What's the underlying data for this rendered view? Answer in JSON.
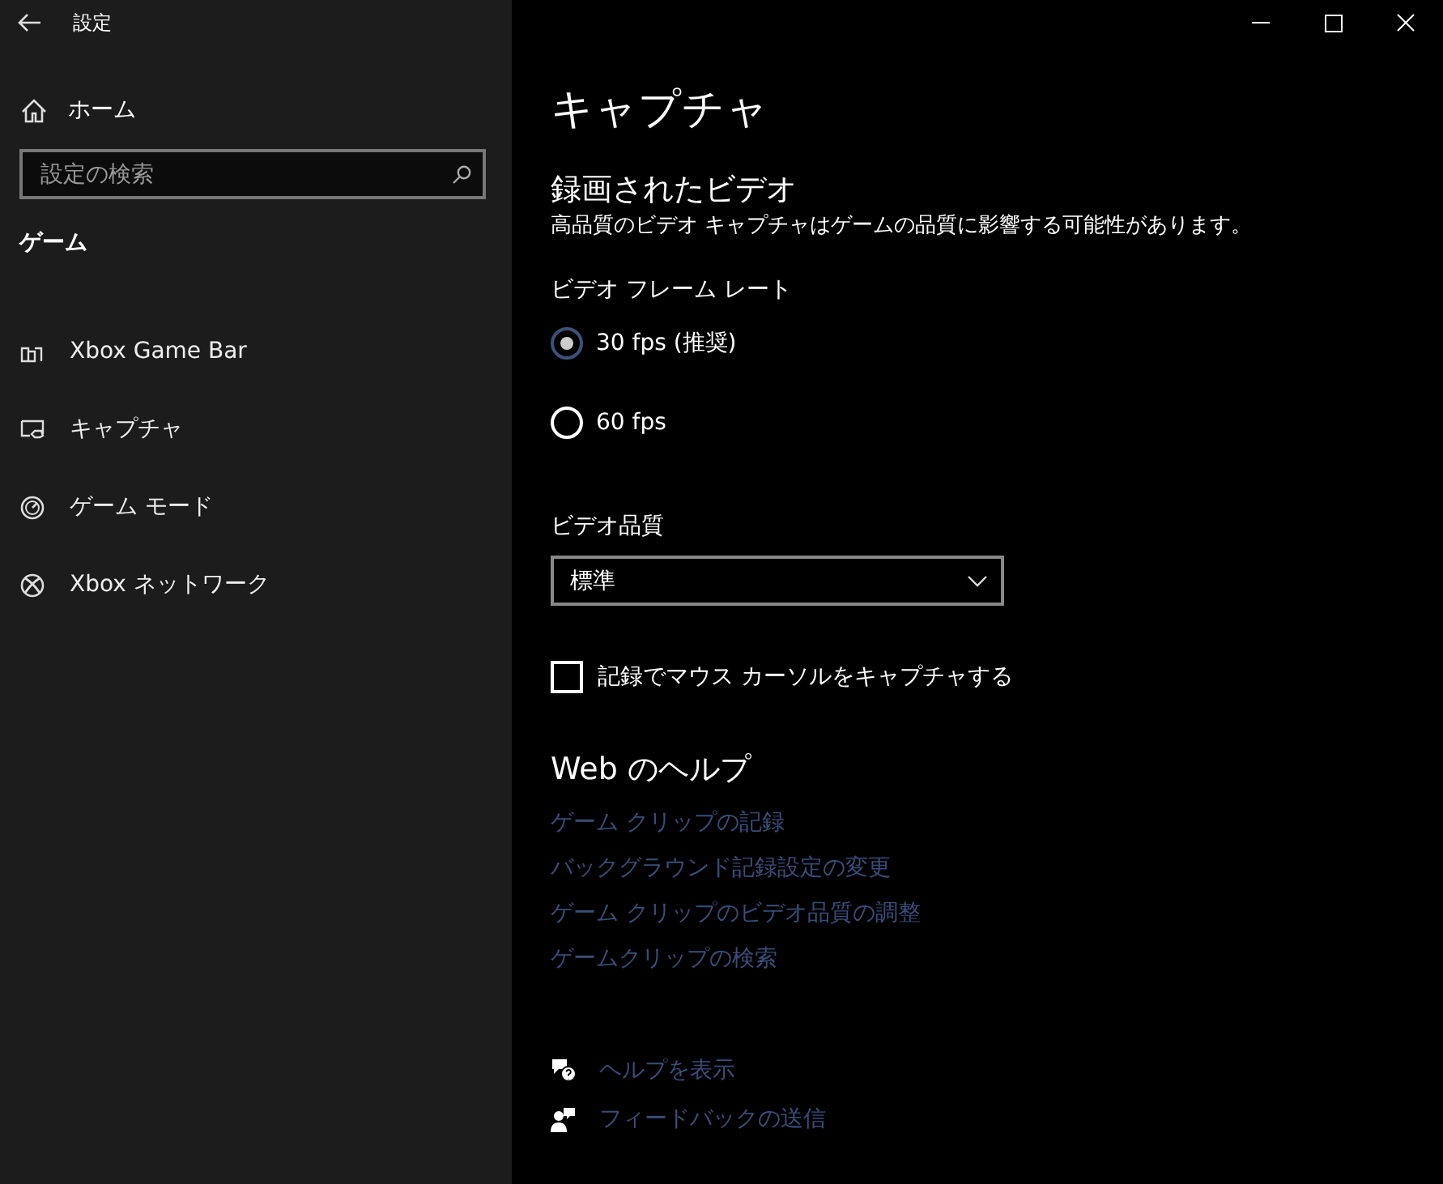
{
  "window": {
    "title": "設定"
  },
  "sidebar": {
    "home": "ホーム",
    "search": {
      "placeholder": "設定の検索"
    },
    "section": "ゲーム",
    "items": [
      {
        "kind": "gamebar",
        "label": "Xbox Game Bar"
      },
      {
        "kind": "capture",
        "label": "キャプチャ"
      },
      {
        "kind": "gamemode",
        "label": "ゲーム モード"
      },
      {
        "kind": "xbox",
        "label": "Xbox ネットワーク"
      }
    ]
  },
  "page": {
    "title": "キャプチャ",
    "section": "録画されたビデオ",
    "description": "高品質のビデオ キャプチャはゲームの品質に影響する可能性があります。",
    "frame_rate": {
      "label": "ビデオ フレーム レート",
      "options": [
        {
          "label": "30 fps (推奨)",
          "selected": true
        },
        {
          "label": "60 fps",
          "selected": false
        }
      ]
    },
    "quality": {
      "label": "ビデオ品質",
      "value": "標準"
    },
    "cursor_checkbox": {
      "label": "記録でマウス カーソルをキャプチャする",
      "checked": false
    },
    "help": {
      "title": "Web のヘルプ",
      "links": [
        "ゲーム クリップの記録",
        "バックグラウンド記録設定の変更",
        "ゲーム クリップのビデオ品質の調整",
        "ゲームクリップの検索"
      ]
    },
    "footer": [
      {
        "kind": "help",
        "label": "ヘルプを表示"
      },
      {
        "kind": "feedback",
        "label": "フィードバックの送信"
      }
    ]
  }
}
